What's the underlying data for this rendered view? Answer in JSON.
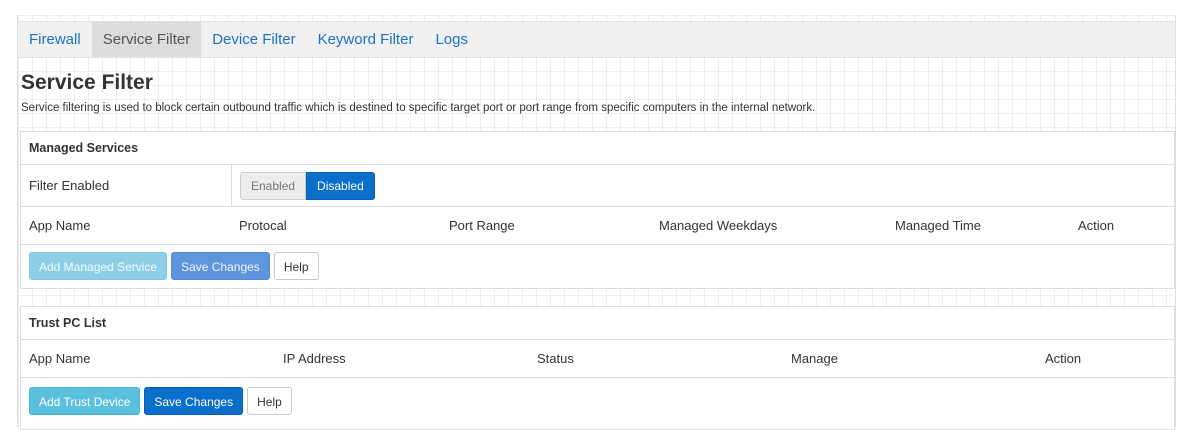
{
  "top_clipped_text": "...",
  "tabs": [
    "Firewall",
    "Service Filter",
    "Device Filter",
    "Keyword Filter",
    "Logs"
  ],
  "active_tab": "Service Filter",
  "page": {
    "title": "Service Filter",
    "description": "Service filtering is used to block certain outbound traffic which is destined to specific target port or port range from specific computers in the internal network."
  },
  "managed": {
    "heading": "Managed Services",
    "filter_label": "Filter Enabled",
    "toggle": {
      "enabled": "Enabled",
      "disabled": "Disabled",
      "selected": "Disabled"
    },
    "columns": [
      "App Name",
      "Protocal",
      "Port Range",
      "Managed Weekdays",
      "Managed Time",
      "Action"
    ],
    "buttons": {
      "add": "Add Managed Service",
      "save": "Save Changes",
      "help": "Help"
    }
  },
  "trust": {
    "heading": "Trust PC List",
    "columns": [
      "App Name",
      "IP Address",
      "Status",
      "Manage",
      "Action"
    ],
    "buttons": {
      "add": "Add Trust Device",
      "save": "Save Changes",
      "help": "Help"
    }
  },
  "colors": {
    "link": "#1a73c1",
    "primary": "#0a6ecb",
    "info": "#5bc0de"
  }
}
